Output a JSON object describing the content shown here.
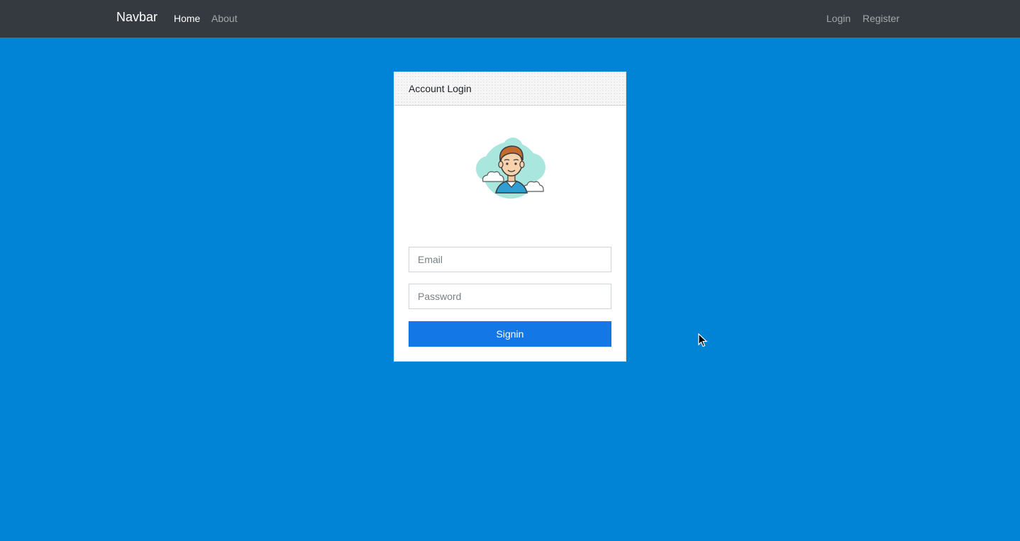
{
  "navbar": {
    "brand": "Navbar",
    "left_links": [
      {
        "label": "Home",
        "active": true
      },
      {
        "label": "About",
        "active": false
      }
    ],
    "right_links": [
      {
        "label": "Login"
      },
      {
        "label": "Register"
      }
    ]
  },
  "login_card": {
    "title": "Account Login",
    "email": {
      "value": "",
      "placeholder": "Email"
    },
    "password": {
      "value": "",
      "placeholder": "Password"
    },
    "submit_label": "Signin",
    "avatar_icon": "user-avatar-icon"
  },
  "colors": {
    "page_background": "#0284d6",
    "navbar_background": "#343a40",
    "button_primary": "#1378e6"
  }
}
